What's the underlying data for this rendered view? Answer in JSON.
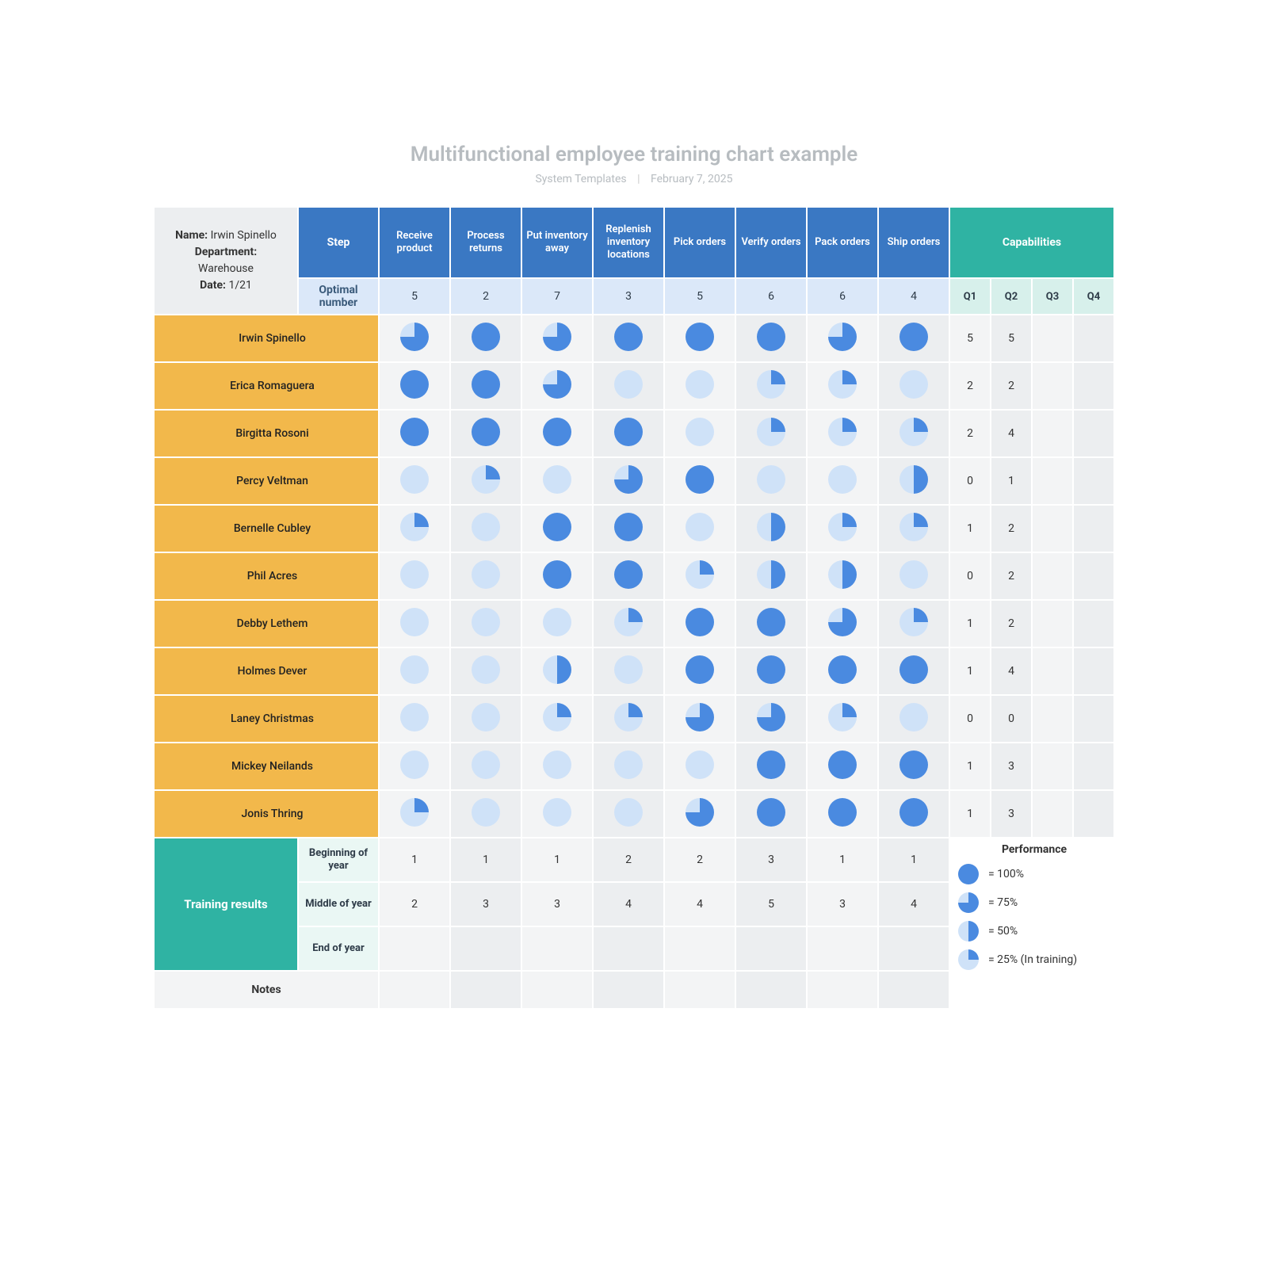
{
  "title": "Multifunctional employee training chart example",
  "subtitle_left": "System Templates",
  "subtitle_right": "February 7, 2025",
  "info": {
    "name_label": "Name:",
    "name": "Irwin Spinello",
    "dept_label": "Department:",
    "dept": "Warehouse",
    "date_label": "Date:",
    "date": "1/21"
  },
  "step_label": "Step",
  "optimal_label": "Optimal number",
  "capabilities_label": "Capabilities",
  "quarters": [
    "Q1",
    "Q2",
    "Q3",
    "Q4"
  ],
  "tasks": [
    "Receive product",
    "Process returns",
    "Put inventory away",
    "Replenish inventory locations",
    "Pick orders",
    "Verify orders",
    "Pack orders",
    "Ship orders"
  ],
  "optimal": [
    5,
    2,
    7,
    3,
    5,
    6,
    6,
    4
  ],
  "training_results_label": "Training results",
  "periods": [
    "Beginning of year",
    "Middle of year",
    "End of year"
  ],
  "training_results": {
    "Beginning of year": [
      1,
      1,
      1,
      2,
      2,
      3,
      1,
      1
    ],
    "Middle of year": [
      2,
      3,
      3,
      4,
      4,
      5,
      3,
      4
    ],
    "End of year": [
      "",
      "",
      "",
      "",
      "",
      "",
      "",
      ""
    ]
  },
  "notes_label": "Notes",
  "legend": {
    "title": "Performance",
    "items": [
      {
        "pct": 100,
        "label": "= 100%"
      },
      {
        "pct": 75,
        "label": "= 75%"
      },
      {
        "pct": 50,
        "label": "= 50%"
      },
      {
        "pct": 25,
        "label": "= 25% (In training)"
      }
    ]
  },
  "colors": {
    "pie_full": "#4a8ae0",
    "pie_empty": "#cfe2f8",
    "task_hdr": "#3a78c3",
    "cap_hdr": "#2fb3a3",
    "emp": "#f2b84b"
  },
  "chart_data": {
    "type": "heatmap",
    "title": "Multifunctional employee training chart example",
    "x": [
      "Receive product",
      "Process returns",
      "Put inventory away",
      "Replenish inventory locations",
      "Pick orders",
      "Verify orders",
      "Pack orders",
      "Ship orders"
    ],
    "y": [
      "Irwin Spinello",
      "Erica Romaguera",
      "Birgitta Rosoni",
      "Percy Veltman",
      "Bernelle Cubley",
      "Phil Acres",
      "Debby Lethem",
      "Holmes Dever",
      "Laney Christmas",
      "Mickey Neilands",
      "Jonis Thring"
    ],
    "values_pct": [
      [
        75,
        100,
        75,
        100,
        100,
        100,
        75,
        100
      ],
      [
        100,
        100,
        75,
        0,
        0,
        25,
        25,
        0
      ],
      [
        100,
        100,
        100,
        100,
        0,
        25,
        25,
        25
      ],
      [
        0,
        25,
        0,
        75,
        100,
        0,
        0,
        50
      ],
      [
        25,
        0,
        100,
        100,
        0,
        50,
        25,
        25
      ],
      [
        0,
        0,
        100,
        100,
        25,
        50,
        50,
        0
      ],
      [
        0,
        0,
        0,
        25,
        100,
        100,
        75,
        25
      ],
      [
        0,
        0,
        50,
        0,
        100,
        100,
        100,
        100
      ],
      [
        0,
        0,
        25,
        25,
        75,
        75,
        25,
        0
      ],
      [
        0,
        0,
        0,
        0,
        0,
        100,
        100,
        100
      ],
      [
        25,
        0,
        0,
        0,
        75,
        100,
        100,
        100
      ]
    ],
    "capabilities": {
      "Q1": [
        5,
        2,
        2,
        0,
        1,
        0,
        1,
        1,
        0,
        1,
        1
      ],
      "Q2": [
        5,
        2,
        4,
        1,
        2,
        2,
        2,
        4,
        0,
        3,
        3
      ],
      "Q3": [
        "",
        "",
        "",
        "",
        "",
        "",
        "",
        "",
        "",
        "",
        ""
      ],
      "Q4": [
        "",
        "",
        "",
        "",
        "",
        "",
        "",
        "",
        "",
        "",
        ""
      ]
    },
    "optimal_number": [
      5,
      2,
      7,
      3,
      5,
      6,
      6,
      4
    ],
    "training_results": {
      "Beginning of year": [
        1,
        1,
        1,
        2,
        2,
        3,
        1,
        1
      ],
      "Middle of year": [
        2,
        3,
        3,
        4,
        4,
        5,
        3,
        4
      ],
      "End of year": [
        "",
        "",
        "",
        "",
        "",
        "",
        "",
        ""
      ]
    },
    "value_scale": [
      0,
      25,
      50,
      75,
      100
    ],
    "value_meaning": {
      "0": "none",
      "25": "in training",
      "50": "50%",
      "75": "75%",
      "100": "100%"
    }
  }
}
